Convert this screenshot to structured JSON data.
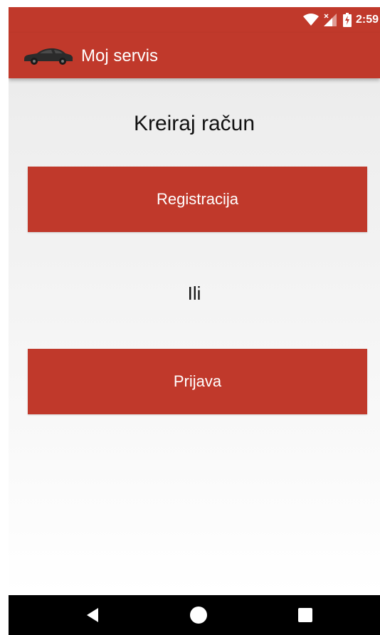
{
  "status_bar": {
    "time": "2:59",
    "icons": [
      "wifi-icon",
      "cell-signal-icon",
      "battery-charging-icon"
    ]
  },
  "app_bar": {
    "logo_icon": "car-icon",
    "title": "Moj servis"
  },
  "main": {
    "heading": "Kreiraj račun",
    "register_button_label": "Registracija",
    "or_text": "Ili",
    "login_button_label": "Prijava"
  },
  "nav_bar": {
    "icons": [
      "back-icon",
      "home-icon",
      "recents-icon"
    ]
  },
  "colors": {
    "primary": "#c0392b",
    "background": "#f2f2f2",
    "nav_bar": "#000000",
    "text": "#111111",
    "on_primary": "#ffffff"
  }
}
